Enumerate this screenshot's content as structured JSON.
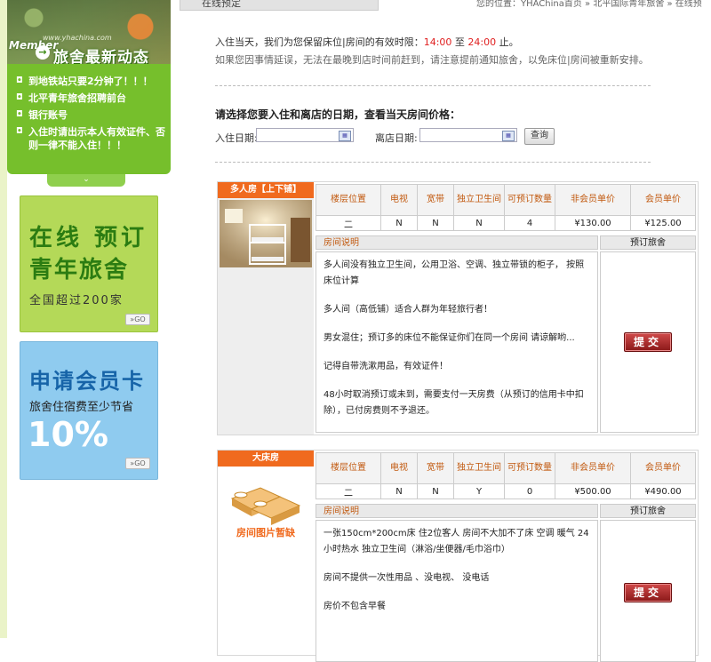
{
  "sidebar": {
    "banner_member": "Member",
    "banner_watermark": "www.yhachina.com",
    "banner_title": "旅舍最新动态",
    "news": [
      "到地铁站只要2分钟了！！！",
      "北平青年旅舍招聘前台",
      "银行账号",
      "入住时请出示本人有效证件、否则一律不能入住！！！"
    ],
    "more_glyph": "⌄",
    "promo_booking": {
      "line1": "在线 预订",
      "line2": "青年旅舍",
      "line3": "全国超过200家",
      "go": "»GO"
    },
    "promo_member": {
      "line1": "申请会员卡",
      "line2": "旅舍住宿费至少节省",
      "line3": "10%",
      "go": "»GO"
    }
  },
  "header": {
    "tab_label": "在线预定",
    "breadcrumb": "您的位置：YHAChina首页 » 北平国际青年旅舍 » 在线预"
  },
  "notice": {
    "line1_prefix": "入住当天，我们为您保留床位|房间的有效时限：",
    "time_start": "14:00",
    "line1_mid": " 至 ",
    "time_end": "24:00",
    "line1_suffix": " 止。",
    "line2": "如果您因事情延误，无法在最晚到店时间前赶到，请注意提前通知旅舍，以免床位|房间被重新安排。"
  },
  "date_select": {
    "heading": "请选择您要入住和离店的日期，查看当天房间价格：",
    "checkin_label": "入住日期:",
    "checkin_value": "",
    "checkout_label": "离店日期:",
    "checkout_value": "",
    "query_button": "查询"
  },
  "table_headers": {
    "floor": "楼层位置",
    "tv": "电视",
    "broadband": "宽带",
    "bath": "独立卫生间",
    "count": "可预订数量",
    "nonmember": "非会员单价",
    "member": "会员单价",
    "desc": "房间说明",
    "book": "预订旅舍"
  },
  "rooms": [
    {
      "name": "多人房【上下铺】",
      "floor": "二",
      "tv": "N",
      "broadband": "N",
      "bath": "N",
      "count": "4",
      "nonmember_price": "¥130.00",
      "member_price": "¥125.00",
      "desc": [
        "多人间没有独立卫生间，公用卫浴、空调、独立带锁的柜子， 按照床位计算",
        "多人间（高低铺）适合人群为年轻旅行者！",
        "男女混住；预订多的床位不能保证你们在同一个房间 请谅解哟...",
        "记得自带洗漱用品，有效证件！",
        "48小时取消预订或未到，需要支付一天房费（从预订的信用卡中扣除），已付房费则不予退还。"
      ],
      "submit": "提交"
    },
    {
      "name": "大床房",
      "photo_placeholder": "房间图片暂缺",
      "floor": "二",
      "tv": "N",
      "broadband": "N",
      "bath": "Y",
      "count": "0",
      "nonmember_price": "¥500.00",
      "member_price": "¥490.00",
      "desc": [
        "一张150cm*200cm床 住2位客人 房间不大加不了床 空调 暖气 24小时热水 独立卫生间（淋浴/坐便器/毛巾浴巾）",
        "房间不提供一次性用品 、没电视、 没电话",
        "房价不包含早餐"
      ],
      "submit": "提交"
    }
  ],
  "colors": {
    "sidebar_green": "#76bf2c",
    "room_title_orange": "#f06a1e",
    "price_red": "#e01818",
    "submit_red": "#a82020"
  }
}
